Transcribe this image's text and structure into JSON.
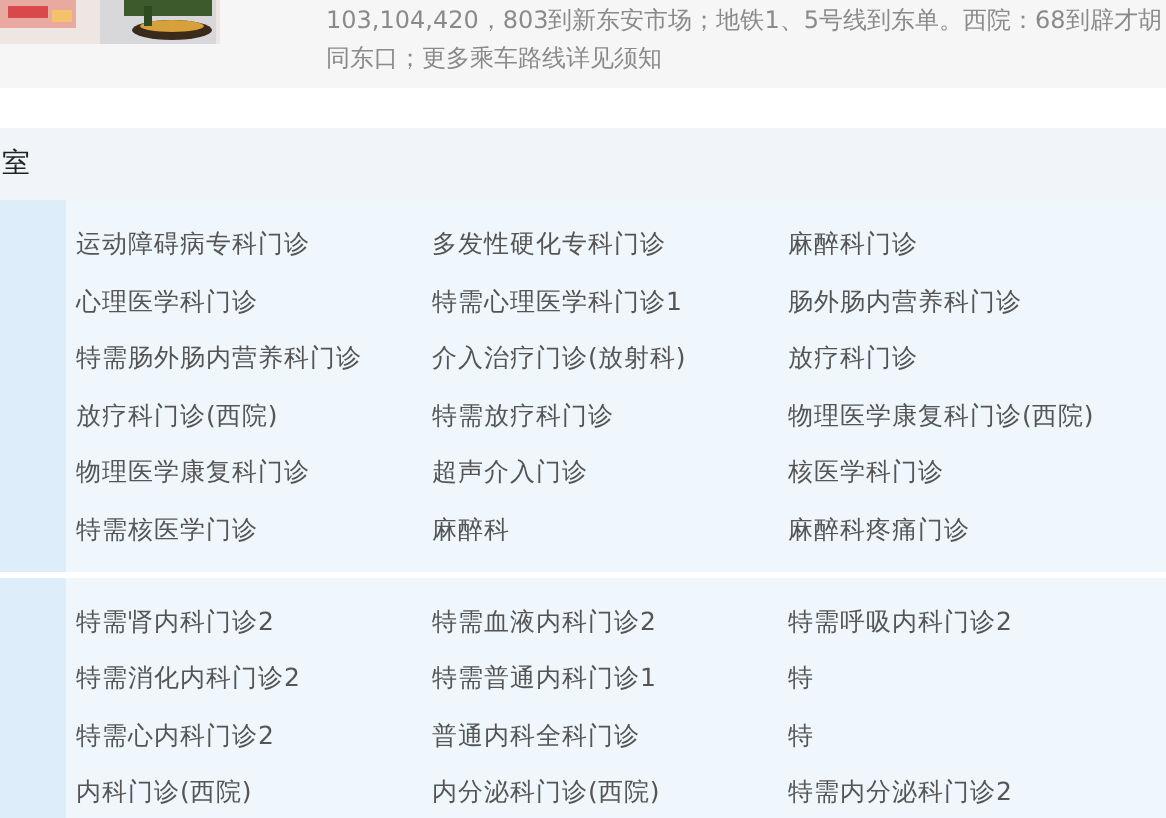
{
  "header": {
    "address_lines": [
      "103,104,420，803到新东安市场；地铁1、5号线到东单。西院：68到辟才胡",
      "同东口；更多乘车路线详见须知"
    ]
  },
  "section": {
    "title": "室",
    "groups": [
      {
        "items": [
          "运动障碍病专科门诊",
          "多发性硬化专科门诊",
          "麻醉科门诊",
          "心理医学科门诊",
          "特需心理医学科门诊1",
          "肠外肠内营养科门诊",
          "特需肠外肠内营养科门诊",
          "介入治疗门诊(放射科)",
          "放疗科门诊",
          "放疗科门诊(西院)",
          "特需放疗科门诊",
          "物理医学康复科门诊(西院)",
          "物理医学康复科门诊",
          "超声介入门诊",
          "核医学科门诊",
          "特需核医学门诊",
          "麻醉科",
          "麻醉科疼痛门诊"
        ]
      },
      {
        "items": [
          "特需肾内科门诊2",
          "特需血液内科门诊2",
          "特需呼吸内科门诊2",
          "特需消化内科门诊2",
          "特需普通内科门诊1",
          "特",
          "特需心内科门诊2",
          "普通内科全科门诊",
          "特",
          "内科门诊(西院)",
          "内分泌科门诊(西院)",
          "特需内分泌科门诊2"
        ]
      }
    ]
  }
}
